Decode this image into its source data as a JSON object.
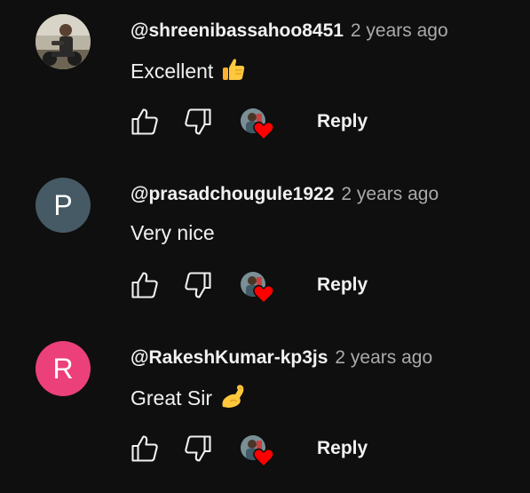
{
  "comments": [
    {
      "author": "@shreenibassahoo8451",
      "time": "2 years ago",
      "text": "Excellent",
      "emoji_icon": "thumbs-up-emoji",
      "avatar_type": "photo",
      "avatar_letter": "",
      "avatar_color": "#9a8a70",
      "reply_label": "Reply"
    },
    {
      "author": "@prasadchougule1922",
      "time": "2 years ago",
      "text": "Very nice",
      "emoji_icon": "",
      "avatar_type": "letter",
      "avatar_letter": "P",
      "avatar_color": "#455a64",
      "reply_label": "Reply"
    },
    {
      "author": "@RakeshKumar-kp3js",
      "time": "2 years ago",
      "text": "Great Sir",
      "emoji_icon": "flexed-biceps-emoji",
      "avatar_type": "letter",
      "avatar_letter": "R",
      "avatar_color": "#ec407a",
      "reply_label": "Reply"
    }
  ],
  "colors": {
    "background": "#0f0f0f",
    "text_primary": "#f1f1f1",
    "text_secondary": "#aaaaaa",
    "heart": "#ff0000",
    "emoji_yellow": "#ffc83d"
  },
  "icons": {
    "like": "thumb-up-outline-icon",
    "dislike": "thumb-down-outline-icon",
    "creator_heart": "creator-heart-icon"
  }
}
